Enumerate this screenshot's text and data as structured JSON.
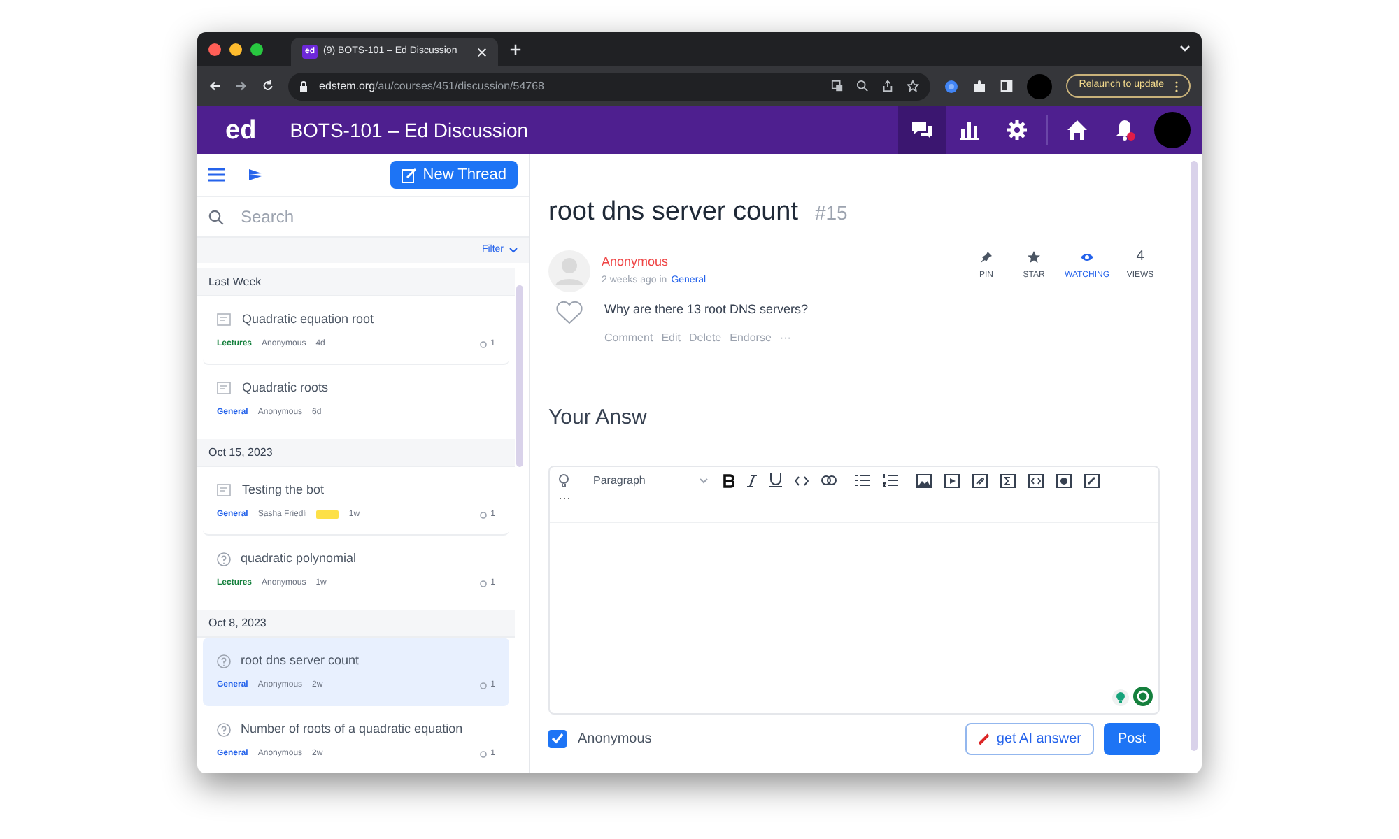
{
  "browser": {
    "tab_title": "(9) BOTS-101 – Ed Discussion",
    "favicon": "ed",
    "url_host": "edstem.org",
    "url_path": "/au/courses/451/discussion/54768",
    "relaunch_label": "Relaunch to update"
  },
  "header": {
    "logo": "ed",
    "course_title": "BOTS-101 – Ed Discussion",
    "nav": [
      {
        "kind": "discussion",
        "selected": true
      },
      {
        "kind": "analytics",
        "selected": false
      },
      {
        "kind": "settings",
        "selected": false
      },
      {
        "kind": "home",
        "selected": false
      },
      {
        "kind": "notifications",
        "selected": false
      }
    ]
  },
  "sidebar": {
    "new_thread_label": "New Thread",
    "search_placeholder": "Search",
    "filter_label": "Filter",
    "groups": [
      {
        "label": "Last Week",
        "threads": [
          {
            "kind": "post",
            "title": "Quadratic equation root",
            "category": "Lectures",
            "color": "#15803d",
            "author": "Anonymous",
            "badge": false,
            "time": "4d",
            "replies": "1",
            "selected": false
          },
          {
            "kind": "post",
            "title": "Quadratic roots",
            "category": "General",
            "color": "#2563eb",
            "author": "Anonymous",
            "badge": false,
            "time": "6d",
            "selected": false
          }
        ]
      },
      {
        "label": "Oct 15, 2023",
        "threads": [
          {
            "kind": "post",
            "title": "Testing the bot",
            "category": "General",
            "color": "#2563eb",
            "author": "Sasha Friedli",
            "badge": true,
            "time": "1w",
            "replies": "1",
            "selected": false
          },
          {
            "kind": "question",
            "title": "quadratic polynomial",
            "category": "Lectures",
            "color": "#15803d",
            "author": "Anonymous",
            "badge": false,
            "time": "1w",
            "replies": "1",
            "selected": false
          }
        ]
      },
      {
        "label": "Oct 8, 2023",
        "threads": [
          {
            "kind": "question",
            "title": "root dns server count",
            "category": "General",
            "color": "#2563eb",
            "author": "Anonymous",
            "badge": false,
            "time": "2w",
            "replies": "1",
            "selected": true
          },
          {
            "kind": "question",
            "title": "Number of roots of a quadratic equation",
            "category": "General",
            "color": "#2563eb",
            "author": "Anonymous",
            "badge": false,
            "time": "2w",
            "replies": "1",
            "selected": false
          }
        ]
      }
    ]
  },
  "post": {
    "title": "root dns server count",
    "number": "#15",
    "author": "Anonymous",
    "meta_prefix": "2 weeks ago in",
    "category": "General",
    "actions": [
      {
        "kind": "pin",
        "label": "PIN",
        "selected": false
      },
      {
        "kind": "star",
        "label": "STAR",
        "selected": false
      },
      {
        "kind": "watch",
        "label": "WATCHING",
        "selected": true
      },
      {
        "kind": "views",
        "label": "VIEWS",
        "count": "4",
        "selected": false
      }
    ],
    "body": "Why are there 13 root DNS servers?",
    "links": [
      "Comment",
      "Edit",
      "Delete",
      "Endorse",
      "···"
    ]
  },
  "answer": {
    "heading": "Your Answ",
    "style_label": "Paragraph",
    "more": "···",
    "anonymous": {
      "label": "Anonymous",
      "checked": true
    },
    "ai_button": "get AI answer",
    "post_button": "Post"
  }
}
